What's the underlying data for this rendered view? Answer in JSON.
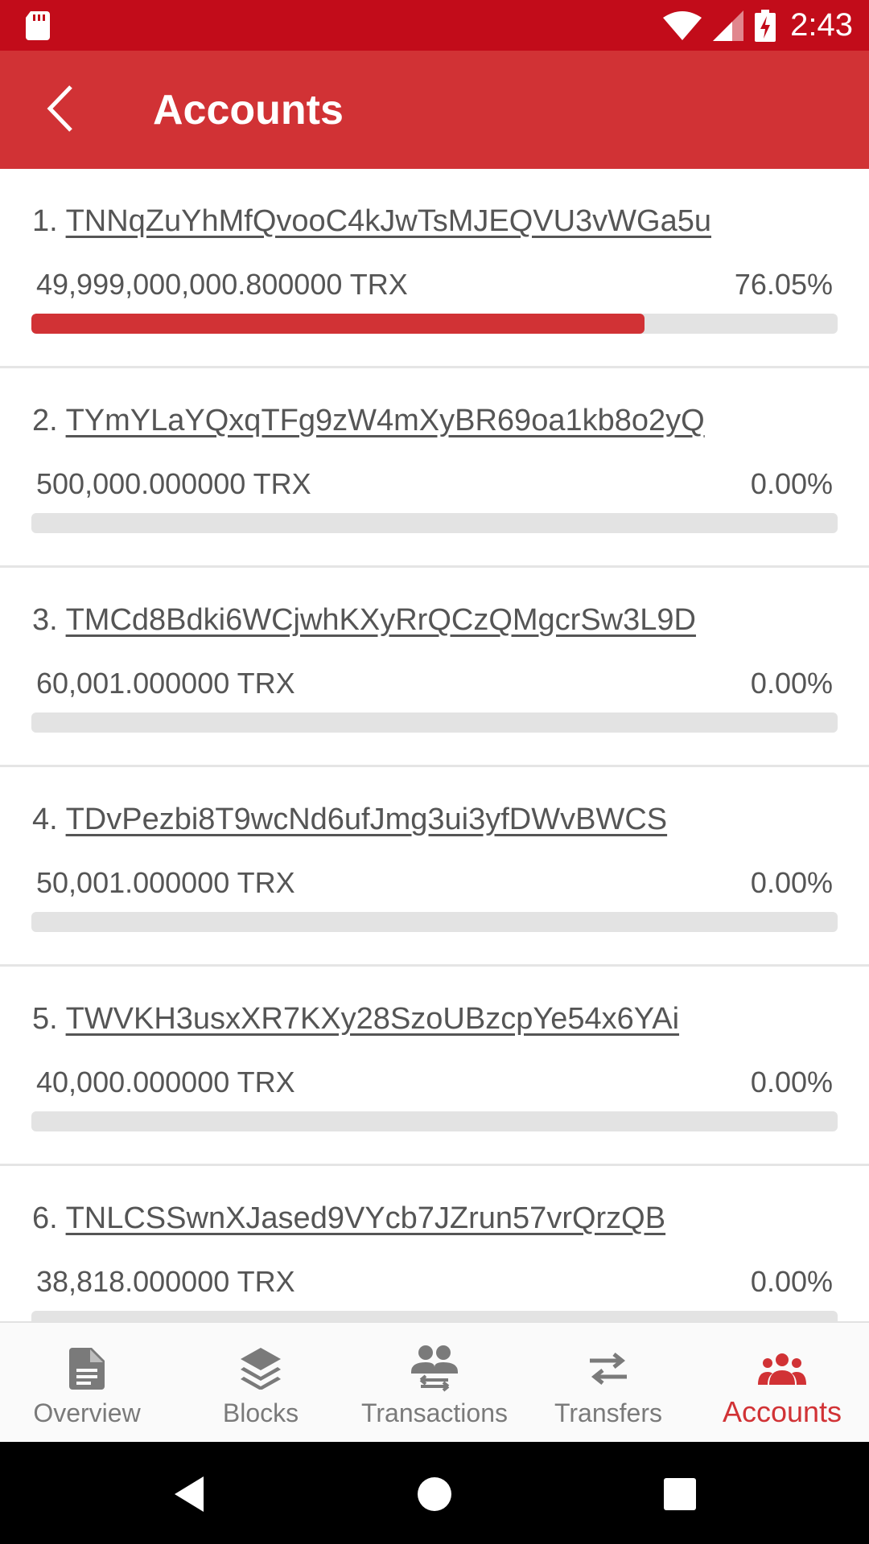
{
  "status_bar": {
    "time": "2:43",
    "icons": [
      "sd-card-icon",
      "wifi-icon",
      "cell-signal-icon",
      "battery-charging-icon"
    ]
  },
  "toolbar": {
    "title": "Accounts",
    "back_icon": "chevron-left-icon"
  },
  "accounts": [
    {
      "rank": "1.",
      "address": "TNNqZuYhMfQvooC4kJwTsMJEQVU3vWGa5u",
      "balance": "49,999,000,000.800000 TRX",
      "percent": "76.05%",
      "share": 0.7605
    },
    {
      "rank": "2.",
      "address": "TYmYLaYQxqTFg9zW4mXyBR69oa1kb8o2yQ",
      "balance": "500,000.000000 TRX",
      "percent": "0.00%",
      "share": 0.0
    },
    {
      "rank": "3.",
      "address": "TMCd8Bdki6WCjwhKXyRrQCzQMgcrSw3L9D",
      "balance": "60,001.000000 TRX",
      "percent": "0.00%",
      "share": 0.0
    },
    {
      "rank": "4.",
      "address": "TDvPezbi8T9wcNd6ufJmg3ui3yfDWvBWCS",
      "balance": "50,001.000000 TRX",
      "percent": "0.00%",
      "share": 0.0
    },
    {
      "rank": "5.",
      "address": "TWVKH3usxXR7KXy28SzoUBzcpYe54x6YAi",
      "balance": "40,000.000000 TRX",
      "percent": "0.00%",
      "share": 0.0
    },
    {
      "rank": "6.",
      "address": "TNLCSSwnXJased9VYcb7JZrun57vrQrzQB",
      "balance": "38,818.000000 TRX",
      "percent": "0.00%",
      "share": 0.0
    }
  ],
  "bottom_nav": [
    {
      "label": "Overview",
      "icon": "document-icon",
      "active": false
    },
    {
      "label": "Blocks",
      "icon": "layers-icon",
      "active": false
    },
    {
      "label": "Transactions",
      "icon": "people-swap-icon",
      "active": false
    },
    {
      "label": "Transfers",
      "icon": "swap-arrows-icon",
      "active": false
    },
    {
      "label": "Accounts",
      "icon": "group-icon",
      "active": true
    }
  ],
  "colors": {
    "status_bar": "#c20c1a",
    "toolbar": "#d13235",
    "accent": "#d13235",
    "bar_track": "#e3e3e3",
    "nav_inactive": "#7a7a7a"
  }
}
